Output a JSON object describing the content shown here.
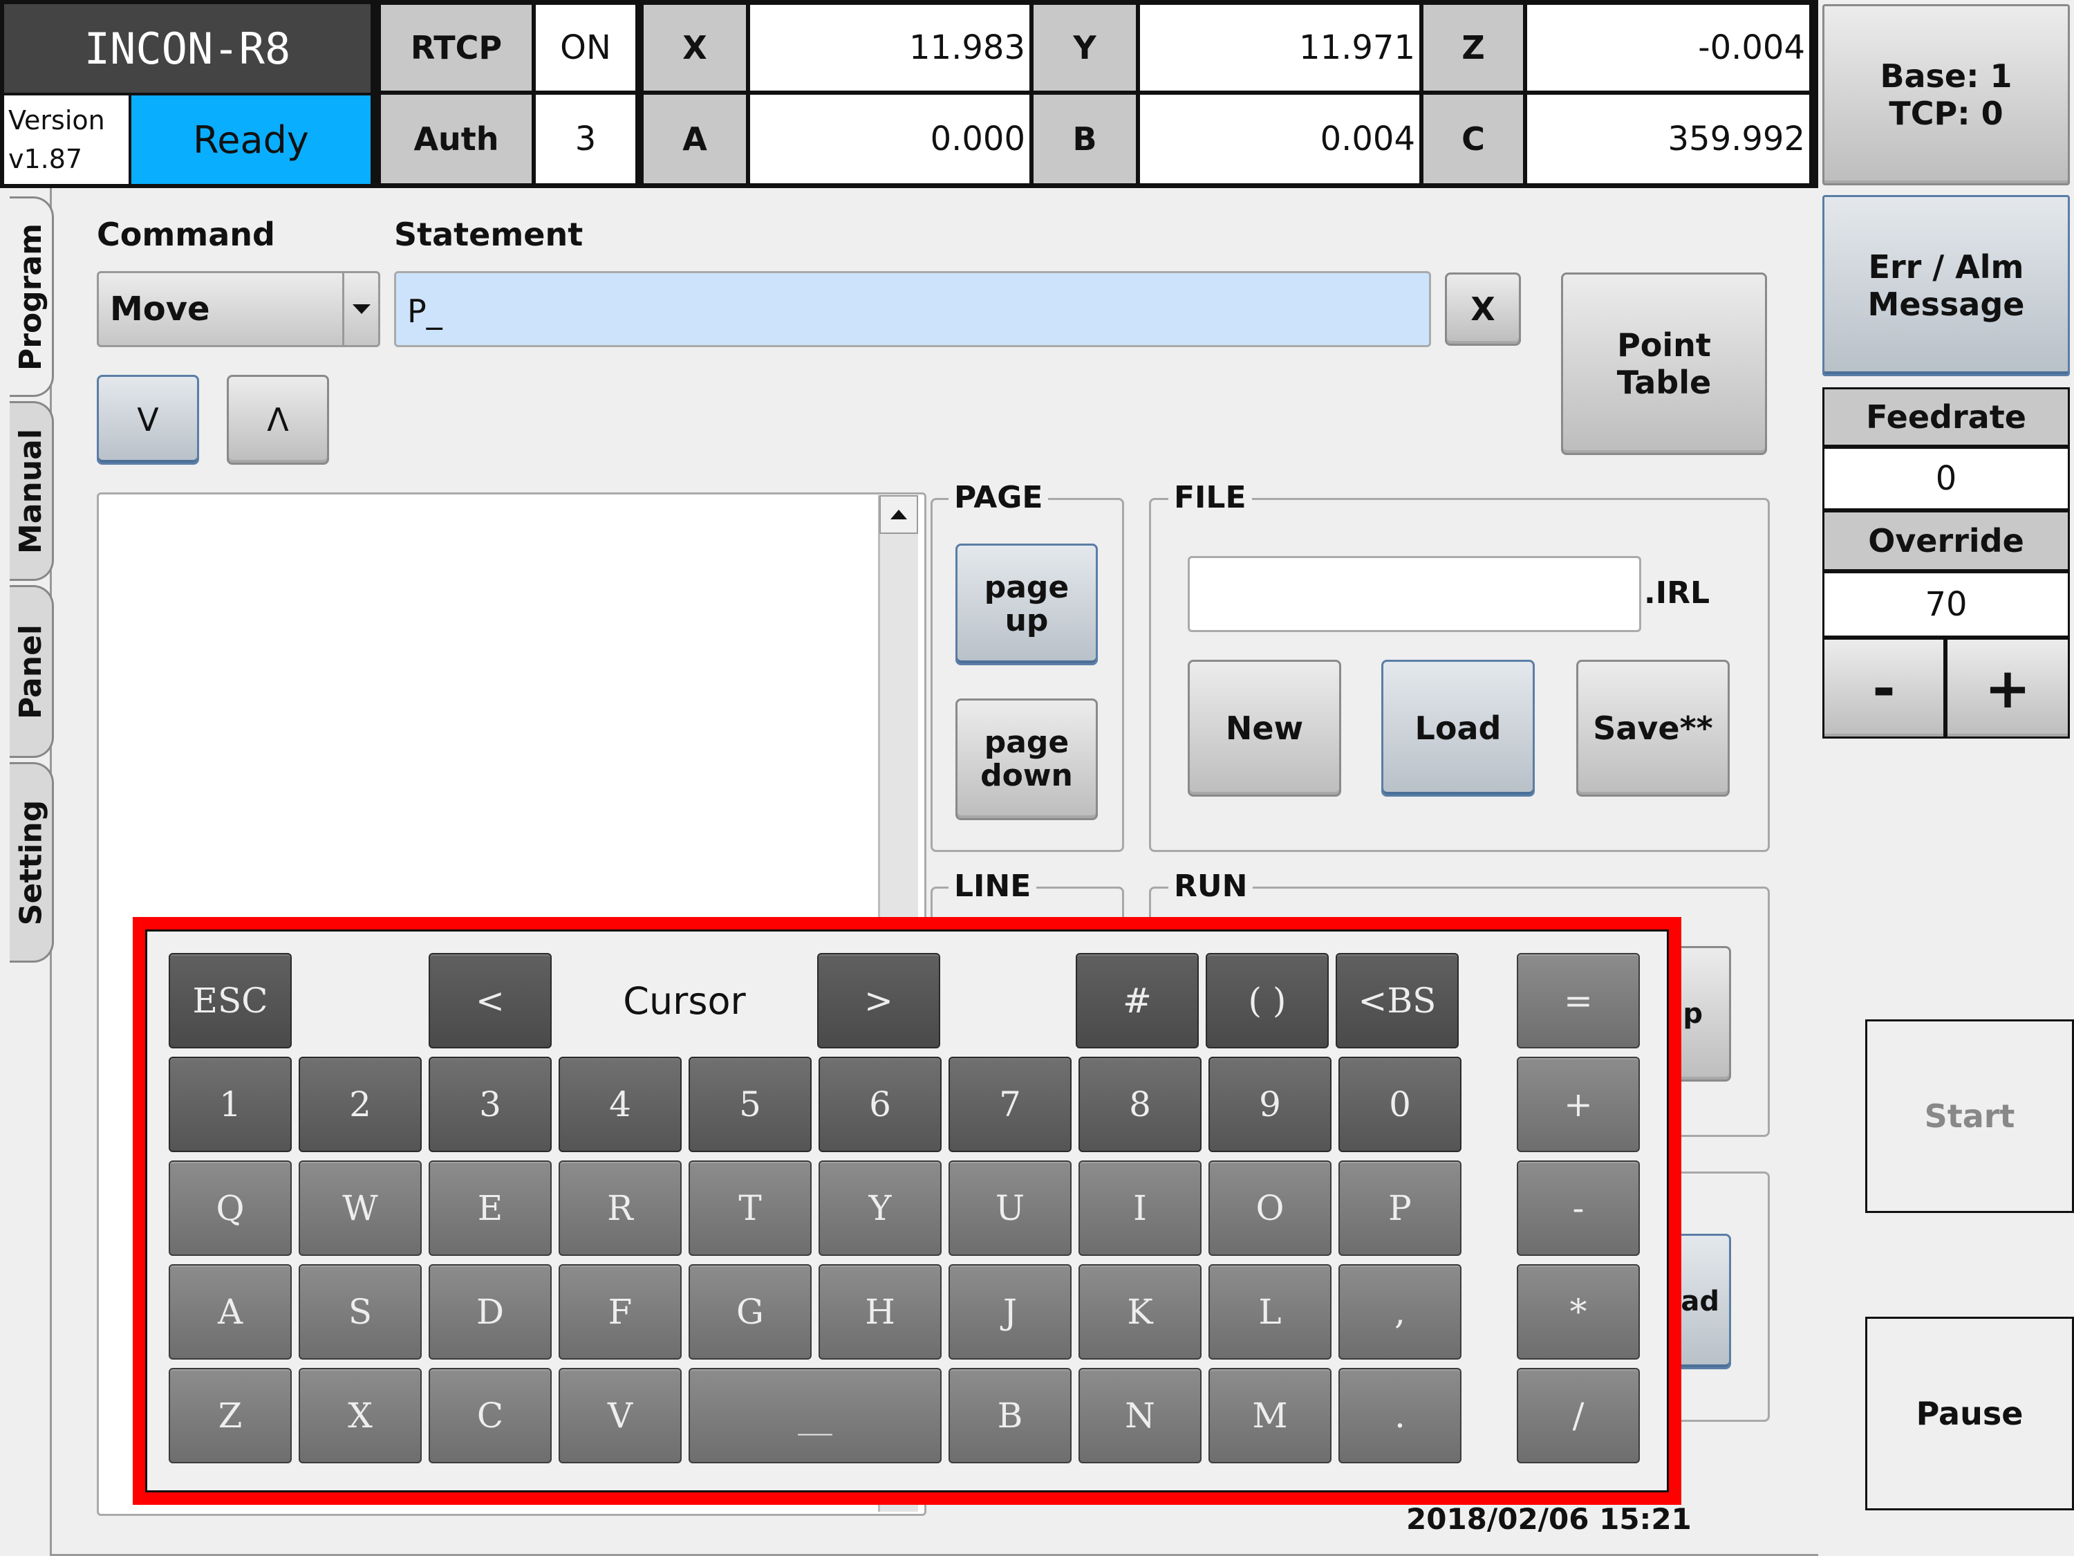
{
  "header": {
    "brand": "INCON-R8",
    "version_label": "Version",
    "version": "v1.87",
    "status": "Ready",
    "rtcp_label": "RTCP",
    "rtcp_value": "ON",
    "auth_label": "Auth",
    "auth_value": "3",
    "coords": [
      {
        "label": "X",
        "value": "11.983"
      },
      {
        "label": "Y",
        "value": "11.971"
      },
      {
        "label": "Z",
        "value": "-0.004"
      },
      {
        "label": "A",
        "value": "0.000"
      },
      {
        "label": "B",
        "value": "0.004"
      },
      {
        "label": "C",
        "value": "359.992"
      }
    ],
    "base_tcp": [
      "Base: 1",
      "TCP: 0"
    ]
  },
  "tabs": [
    "Program",
    "Manual",
    "Panel",
    "Setting"
  ],
  "program": {
    "command_label": "Command",
    "command_value": "Move",
    "statement_label": "Statement",
    "statement_value": "P_",
    "clear_label": "X",
    "down_label": "V",
    "up_label": "Λ",
    "point_table": [
      "Point",
      "Table"
    ],
    "page_legend": "PAGE",
    "page_up": [
      "page",
      "up"
    ],
    "page_down": [
      "page",
      "down"
    ],
    "file_legend": "FILE",
    "file_ext": ".IRL",
    "new_label": "New",
    "load_label": "Load",
    "save_label": "Save**",
    "line_legend": "LINE",
    "run_legend": "RUN"
  },
  "side": {
    "err_alm": [
      "Err / Alm",
      "Message"
    ],
    "feedrate_label": "Feedrate",
    "feedrate_value": "0",
    "override_label": "Override",
    "override_value": "70",
    "minus_label": "-",
    "plus_label": "+",
    "start_label": "Start",
    "pause_label": "Pause"
  },
  "keyboard": {
    "row0": {
      "esc": "ESC",
      "left": "<",
      "cursor": "Cursor",
      "right": ">",
      "hash": "#",
      "paren": "( )",
      "bs": "<BS",
      "eq": "="
    },
    "rows": [
      [
        "1",
        "2",
        "3",
        "4",
        "5",
        "6",
        "7",
        "8",
        "9",
        "0"
      ],
      [
        "Q",
        "W",
        "E",
        "R",
        "T",
        "Y",
        "U",
        "I",
        "O",
        "P"
      ],
      [
        "A",
        "S",
        "D",
        "F",
        "G",
        "H",
        "J",
        "K",
        "L",
        ","
      ],
      [
        "Z",
        "X",
        "C",
        "V",
        "__",
        "B",
        "N",
        "M",
        "."
      ]
    ],
    "ops": [
      "+",
      "-",
      "*",
      "/"
    ],
    "partial_keys": [
      "p",
      "ad"
    ]
  },
  "datetime": "2018/02/06 15:21",
  "colors": {
    "ready": "#0aaeff",
    "statement_bg": "#cde3fb",
    "highlight": "#ff0000"
  }
}
